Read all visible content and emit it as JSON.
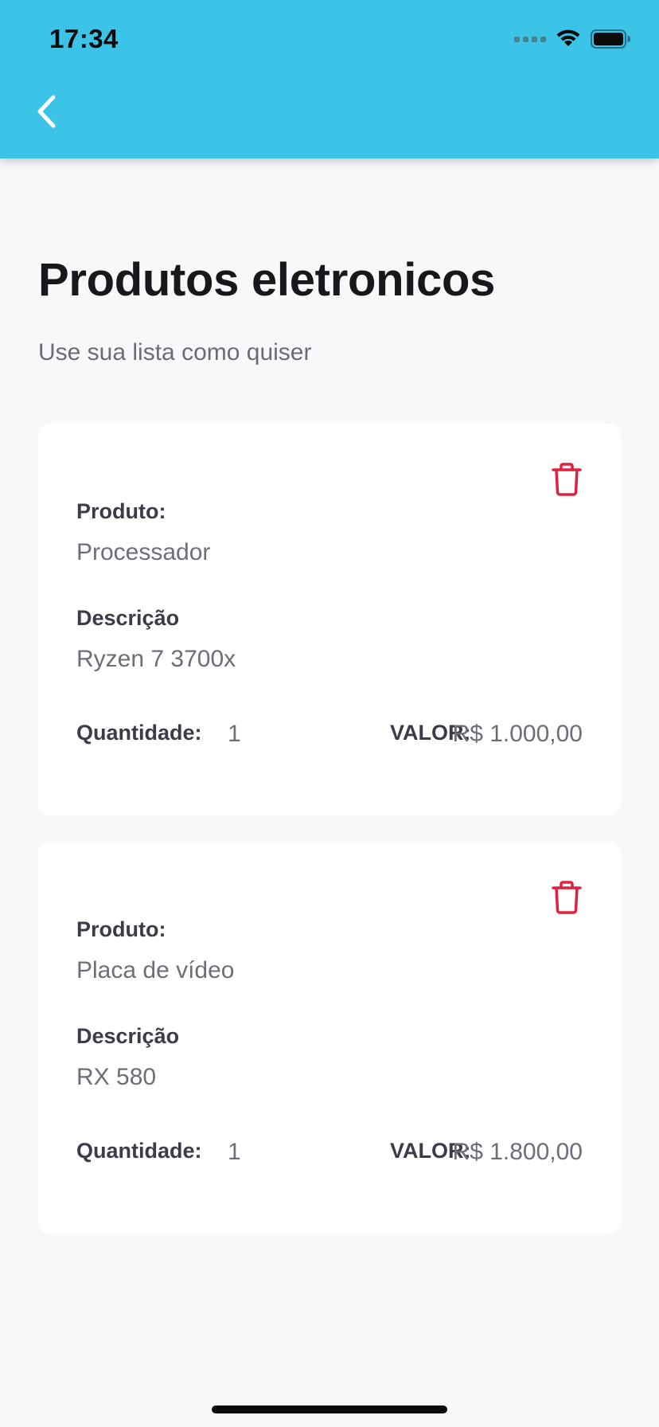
{
  "status_bar": {
    "time": "17:34",
    "icons": [
      "cellular-signal-icon",
      "wifi-icon",
      "battery-icon"
    ]
  },
  "header": {
    "back_icon": "chevron-left-icon",
    "background_color": "#3bc4e8"
  },
  "page": {
    "title": "Produtos eletronicos",
    "subtitle": "Use sua lista como quiser"
  },
  "labels": {
    "product": "Produto:",
    "description": "Descrição",
    "quantity": "Quantidade:",
    "value": "VALOR:"
  },
  "items": [
    {
      "product": "Processador",
      "description": "Ryzen 7 3700x",
      "quantity": "1",
      "value": "R$ 1.000,00"
    },
    {
      "product": "Placa de vídeo",
      "description": "RX 580",
      "quantity": "1",
      "value": "R$ 1.800,00"
    }
  ],
  "colors": {
    "accent": "#3bc4e8",
    "delete": "#e0223f",
    "background": "#f7f8fa",
    "card": "#ffffff"
  }
}
